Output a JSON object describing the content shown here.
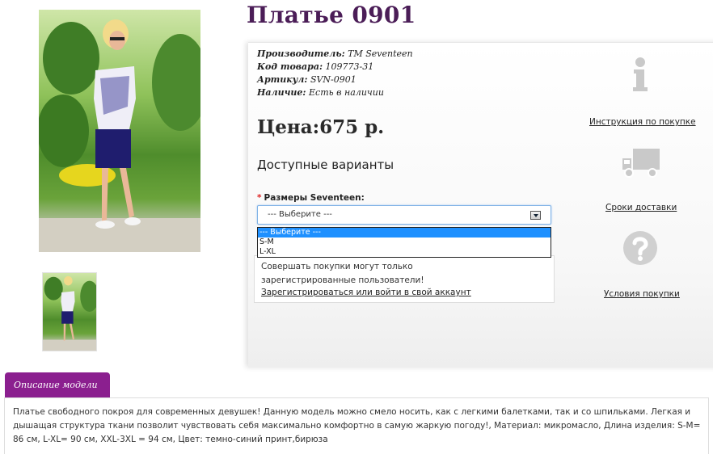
{
  "product": {
    "title": "Платье 0901",
    "specs": [
      {
        "key": "Производитель:",
        "value": "ТМ Seventeen"
      },
      {
        "key": "Код товара:",
        "value": "109773-31"
      },
      {
        "key": "Артикул:",
        "value": "SVN-0901"
      },
      {
        "key": "Наличие:",
        "value": "Есть в наличии"
      }
    ],
    "price": "Цена:675 р."
  },
  "variants": {
    "heading": "Доступные варианты",
    "required_mark": "*",
    "size_label": "Размеры Seventeen:",
    "selected": "--- Выберите ---",
    "options": [
      "--- Выберите ---",
      "S-M",
      "L-XL"
    ]
  },
  "notice": {
    "text": "Совершать покупки могут только зарегистрированные пользователи!",
    "link": "Зарегистрироваться или войти в свой аккаунт"
  },
  "side": [
    {
      "icon": "info-icon",
      "label": "Инструкция по покупке"
    },
    {
      "icon": "truck-icon",
      "label": "Сроки доставки"
    },
    {
      "icon": "question-icon",
      "label": "Условия покупки"
    }
  ],
  "description": {
    "tab": "Описание модели",
    "text": "Платье свободного покроя для современных девушек! Данную модель можно смело носить, как с легкими балетками, так и со шпильками. Легкая и дышащая структура ткани позволит чувствовать себя максимально комфортно в самую жаркую погоду!, Материал: микромасло, Длина изделия: S-M= 86 см, L-XL= 90 см, XXL-3XL = 94 см, Цвет: темно-синий принт,бирюза"
  },
  "colors": {
    "title": "#4b1d57",
    "tab": "#8b1f8f",
    "select_highlight": "#1e90ff"
  }
}
